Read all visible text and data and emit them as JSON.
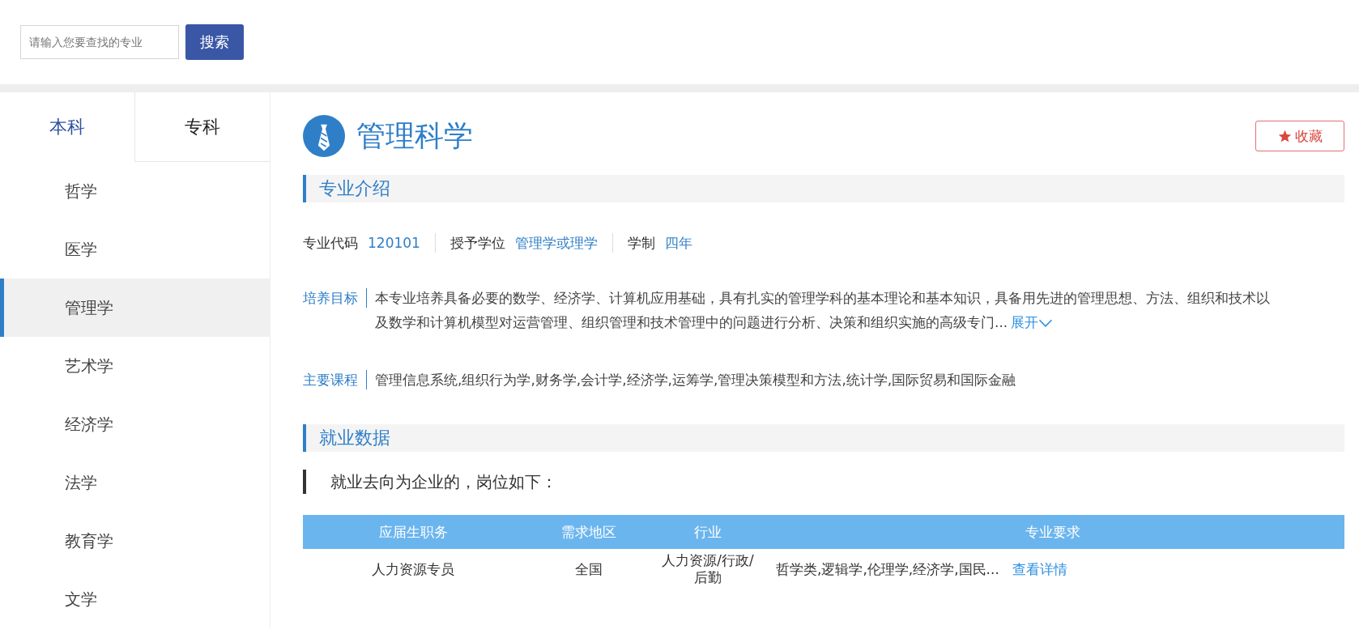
{
  "search": {
    "placeholder": "请输入您要查找的专业",
    "button": "搜索"
  },
  "sidebar": {
    "tabs": [
      {
        "label": "本科",
        "selected": true
      },
      {
        "label": "专科",
        "selected": false
      }
    ],
    "items": [
      {
        "label": "哲学",
        "selected": false
      },
      {
        "label": "医学",
        "selected": false
      },
      {
        "label": "管理学",
        "selected": true
      },
      {
        "label": "艺术学",
        "selected": false
      },
      {
        "label": "经济学",
        "selected": false
      },
      {
        "label": "法学",
        "selected": false
      },
      {
        "label": "教育学",
        "selected": false
      },
      {
        "label": "文学",
        "selected": false
      }
    ]
  },
  "major": {
    "title": "管理科学",
    "favorite": "收藏"
  },
  "intro": {
    "title": "专业介绍",
    "facts": [
      {
        "label": "专业代码",
        "value": "120101"
      },
      {
        "label": "授予学位",
        "value": "管理学或理学"
      },
      {
        "label": "学制",
        "value": "四年"
      }
    ],
    "details": [
      {
        "label": "培养目标",
        "text": "本专业培养具备必要的数学、经济学、计算机应用基础，具有扎实的管理学科的基本理论和基本知识，具备用先进的管理思想、方法、组织和技术以及数学和计算机模型对运营管理、组织管理和技术管理中的问题进行分析、决策和组织实施的高级专门...",
        "more": "展开"
      },
      {
        "label": "主要课程",
        "text": "管理信息系统,组织行为学,财务学,会计学,经济学,运筹学,管理决策模型和方法,统计学,国际贸易和国际金融"
      }
    ]
  },
  "employment": {
    "title": "就业数据",
    "note": "就业去向为企业的，岗位如下：",
    "table": {
      "columns": [
        "应届生职务",
        "需求地区",
        "行业",
        "专业要求"
      ],
      "rows": [
        {
          "cells": [
            "人力资源专员",
            "全国",
            "人力资源/行政/后勤",
            "哲学类,逻辑学,伦理学,经济学,国民..."
          ],
          "link": "查看详情"
        }
      ]
    }
  }
}
